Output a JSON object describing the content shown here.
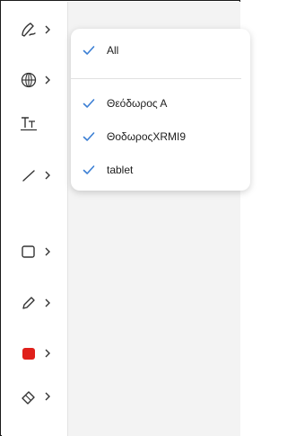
{
  "toolbar": {
    "tools": [
      {
        "name": "pen-tool",
        "icon": "pen-swirl-icon",
        "has_submenu": true
      },
      {
        "name": "web-tool",
        "icon": "globe-icon",
        "has_submenu": true
      },
      {
        "name": "text-tool",
        "icon": "text-format-icon",
        "has_submenu": false
      },
      {
        "name": "line-tool",
        "icon": "line-icon",
        "has_submenu": true
      },
      {
        "name": "rectangle-tool",
        "icon": "rectangle-icon",
        "has_submenu": true
      },
      {
        "name": "pencil-tool",
        "icon": "pencil-icon",
        "has_submenu": true
      },
      {
        "name": "color-tool",
        "icon": "color-swatch-icon",
        "has_submenu": true,
        "color": "#e0201b"
      },
      {
        "name": "eraser-tool",
        "icon": "eraser-icon",
        "has_submenu": true
      }
    ]
  },
  "filter_menu": {
    "options": [
      {
        "label": "All",
        "checked": true
      },
      {
        "label": "Θεόδωρος Α",
        "checked": true
      },
      {
        "label": "ΘοδωροςXRMI9",
        "checked": true
      },
      {
        "label": "tablet",
        "checked": true
      }
    ]
  },
  "colors": {
    "check_accent": "#3b7fd4",
    "swatch_red": "#e0201b"
  }
}
